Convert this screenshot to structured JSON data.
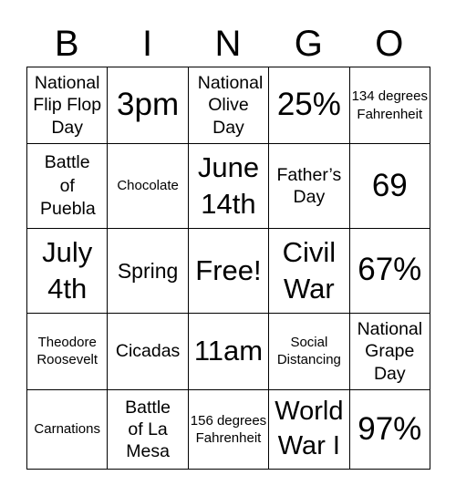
{
  "header": [
    "B",
    "I",
    "N",
    "G",
    "O"
  ],
  "cells": [
    [
      "National Flip Flop Day",
      "3pm",
      "National Olive Day",
      "25%",
      "134 degrees Fahrenheit"
    ],
    [
      "Battle of Puebla",
      "Chocolate",
      "June 14th",
      "Father’s Day",
      "69"
    ],
    [
      "July 4th",
      "Spring",
      "Free!",
      "Civil War",
      "67%"
    ],
    [
      "Theodore Roosevelt",
      "Cicadas",
      "11am",
      "Social Distancing",
      "National Grape Day"
    ],
    [
      "Carnations",
      "Battle of La Mesa",
      "156 degrees Fahrenheit",
      "World War I",
      "97%"
    ]
  ]
}
